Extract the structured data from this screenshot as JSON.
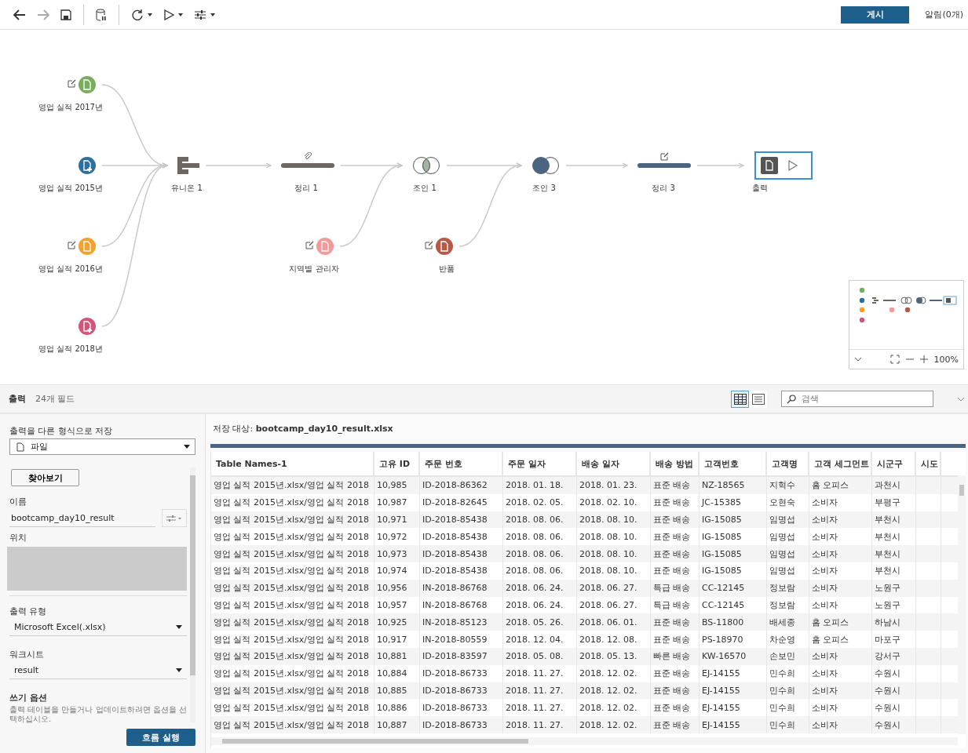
{
  "toolbar": {
    "items": [
      {
        "kind": "back",
        "disabled": false
      },
      {
        "kind": "forward",
        "disabled": true
      },
      {
        "kind": "save",
        "disabled": false
      },
      {
        "kind": "pause-data",
        "disabled": false
      },
      {
        "kind": "refresh",
        "disabled": false
      },
      {
        "kind": "run",
        "disabled": false
      },
      {
        "kind": "options",
        "disabled": false
      }
    ],
    "publish_button": "게시",
    "alerts": "알림(0개)"
  },
  "flow": {
    "nodes": [
      {
        "kind": "input",
        "label": "영업 실적 2017년",
        "color": "#78ad5e",
        "edited": true
      },
      {
        "kind": "input",
        "label": "영업 실적 2015년",
        "color": "#2f6f9c",
        "edited": false
      },
      {
        "kind": "input",
        "label": "영업 실적 2016년",
        "color": "#f4a12d",
        "edited": true
      },
      {
        "kind": "input",
        "label": "영업 실적 2018년",
        "color": "#d15679",
        "edited": false
      },
      {
        "kind": "union",
        "label": "유니온 1"
      },
      {
        "kind": "clean",
        "label": "정리 1",
        "color": "#6d6661",
        "attached": true
      },
      {
        "kind": "input",
        "label": "지역별 관리자",
        "color": "#f3999a",
        "edited": true
      },
      {
        "kind": "join",
        "label": "조인 1",
        "left_filled": false
      },
      {
        "kind": "input",
        "label": "반품",
        "color": "#b65a47",
        "edited": true
      },
      {
        "kind": "join",
        "label": "조인 3",
        "left_filled": true
      },
      {
        "kind": "clean",
        "label": "정리 3",
        "color": "#4b6581",
        "edited": true
      },
      {
        "kind": "output",
        "label": "출력",
        "selected": true
      }
    ],
    "zoom": "100%"
  },
  "panel_header": {
    "title": "출력",
    "fields": "24개 필드",
    "views": [
      {
        "kind": "grid",
        "selected": true
      },
      {
        "kind": "list",
        "selected": false
      }
    ],
    "search": {
      "placeholder": "검색"
    }
  },
  "settings": {
    "save_as_label": "출력을 다른 형식으로 저장",
    "save_as_value": "파일",
    "browse_button": "찾아보기",
    "name_label": "이름",
    "name_value": "bootcamp_day10_result",
    "location_label": "위치",
    "type_label": "출력 유형",
    "type_value": "Microsoft Excel(.xlsx)",
    "sheet_label": "워크시트",
    "sheet_value": "result",
    "write_label": "쓰기 옵션",
    "write_hint": "출력 테이블을 만들거나 업데이트하려면 옵션을 선택하십시오.",
    "run_button": "흐름 실행"
  },
  "preview": {
    "target": "저장 대상: **bootcamp_day10_result.xlsx**",
    "columns": [
      "Table Names-1",
      "고유 ID",
      "주문 번호",
      "주문 일자",
      "배송 일자",
      "배송 방법",
      "고객번호",
      "고객명",
      "고객 세그먼트",
      "시군구",
      "시도"
    ],
    "rows": [
      [
        "영업 실적 2015년.xlsx/영업 실적 2018",
        "10,985",
        "ID-2018-86362",
        "2018. 01. 18.",
        "2018. 01. 23.",
        "표준 배송",
        "NZ-18565",
        "지혁수",
        "홈 오피스",
        "과천시"
      ],
      [
        "영업 실적 2015년.xlsx/영업 실적 2018",
        "10,987",
        "ID-2018-82645",
        "2018. 02. 05.",
        "2018. 02. 10.",
        "표준 배송",
        "JC-15385",
        "오현숙",
        "소비자",
        "부평구"
      ],
      [
        "영업 실적 2015년.xlsx/영업 실적 2018",
        "10,971",
        "ID-2018-85438",
        "2018. 08. 06.",
        "2018. 08. 10.",
        "표준 배송",
        "IG-15085",
        "임명섭",
        "소비자",
        "부천시"
      ],
      [
        "영업 실적 2015년.xlsx/영업 실적 2018",
        "10,972",
        "ID-2018-85438",
        "2018. 08. 06.",
        "2018. 08. 10.",
        "표준 배송",
        "IG-15085",
        "임명섭",
        "소비자",
        "부천시"
      ],
      [
        "영업 실적 2015년.xlsx/영업 실적 2018",
        "10,973",
        "ID-2018-85438",
        "2018. 08. 06.",
        "2018. 08. 10.",
        "표준 배송",
        "IG-15085",
        "임명섭",
        "소비자",
        "부천시"
      ],
      [
        "영업 실적 2015년.xlsx/영업 실적 2018",
        "10,974",
        "ID-2018-85438",
        "2018. 08. 06.",
        "2018. 08. 10.",
        "표준 배송",
        "IG-15085",
        "임명섭",
        "소비자",
        "부천시"
      ],
      [
        "영업 실적 2015년.xlsx/영업 실적 2018",
        "10,956",
        "IN-2018-86768",
        "2018. 06. 24.",
        "2018. 06. 27.",
        "특급 배송",
        "CC-12145",
        "정보람",
        "소비자",
        "노원구"
      ],
      [
        "영업 실적 2015년.xlsx/영업 실적 2018",
        "10,957",
        "IN-2018-86768",
        "2018. 06. 24.",
        "2018. 06. 27.",
        "특급 배송",
        "CC-12145",
        "정보람",
        "소비자",
        "노원구"
      ],
      [
        "영업 실적 2015년.xlsx/영업 실적 2018",
        "10,925",
        "IN-2018-85123",
        "2018. 05. 26.",
        "2018. 06. 01.",
        "표준 배송",
        "BS-11800",
        "배세종",
        "홈 오피스",
        "하남시"
      ],
      [
        "영업 실적 2015년.xlsx/영업 실적 2018",
        "10,917",
        "IN-2018-80559",
        "2018. 12. 04.",
        "2018. 12. 08.",
        "표준 배송",
        "PS-18970",
        "차순영",
        "홈 오피스",
        "마포구"
      ],
      [
        "영업 실적 2015년.xlsx/영업 실적 2018",
        "10,881",
        "ID-2018-83597",
        "2018. 05. 08.",
        "2018. 05. 13.",
        "빠른 배송",
        "KW-16570",
        "손보민",
        "소비자",
        "강서구"
      ],
      [
        "영업 실적 2015년.xlsx/영업 실적 2018",
        "10,884",
        "ID-2018-86733",
        "2018. 11. 27.",
        "2018. 12. 02.",
        "표준 배송",
        "EJ-14155",
        "민수희",
        "소비자",
        "수원시"
      ],
      [
        "영업 실적 2015년.xlsx/영업 실적 2018",
        "10,885",
        "ID-2018-86733",
        "2018. 11. 27.",
        "2018. 12. 02.",
        "표준 배송",
        "EJ-14155",
        "민수희",
        "소비자",
        "수원시"
      ],
      [
        "영업 실적 2015년.xlsx/영업 실적 2018",
        "10,886",
        "ID-2018-86733",
        "2018. 11. 27.",
        "2018. 12. 02.",
        "표준 배송",
        "EJ-14155",
        "민수희",
        "소비자",
        "수원시"
      ],
      [
        "영업 실적 2015년.xlsx/영업 실적 2018",
        "10,887",
        "ID-2018-86733",
        "2018. 11. 27.",
        "2018. 12. 02.",
        "표준 배송",
        "EJ-14155",
        "민수희",
        "소비자",
        "수원시"
      ]
    ]
  }
}
